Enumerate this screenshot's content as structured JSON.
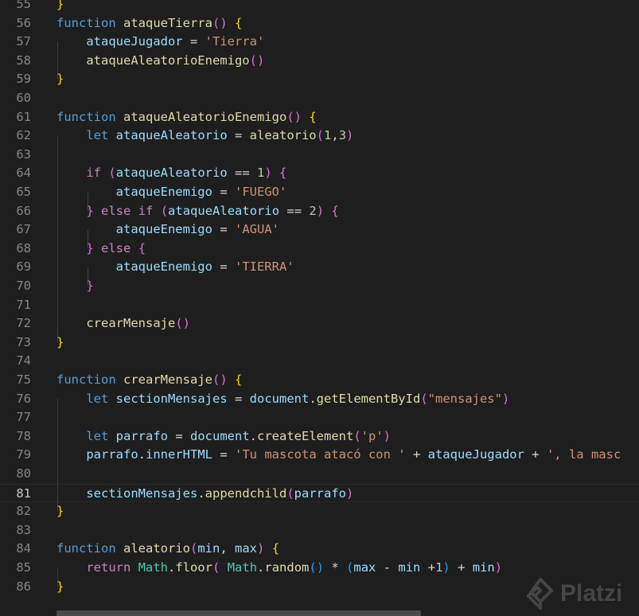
{
  "editor": {
    "lines": [
      {
        "n": "55",
        "tokens": [
          {
            "t": "}",
            "c": "b1"
          }
        ]
      },
      {
        "n": "56",
        "tokens": [
          {
            "t": "function",
            "c": "kw"
          },
          {
            "t": " ",
            "c": "op"
          },
          {
            "t": "ataqueTierra",
            "c": "fn"
          },
          {
            "t": "()",
            "c": "b2"
          },
          {
            "t": " ",
            "c": "op"
          },
          {
            "t": "{",
            "c": "b1"
          }
        ]
      },
      {
        "n": "57",
        "tokens": [
          {
            "t": "    ",
            "c": "op"
          },
          {
            "t": "ataqueJugador",
            "c": "var"
          },
          {
            "t": " = ",
            "c": "op"
          },
          {
            "t": "'Tierra'",
            "c": "str"
          }
        ]
      },
      {
        "n": "58",
        "tokens": [
          {
            "t": "    ",
            "c": "op"
          },
          {
            "t": "ataqueAleatorioEnemigo",
            "c": "fn"
          },
          {
            "t": "()",
            "c": "b2"
          }
        ]
      },
      {
        "n": "59",
        "tokens": [
          {
            "t": "}",
            "c": "b1"
          }
        ]
      },
      {
        "n": "60",
        "tokens": []
      },
      {
        "n": "61",
        "tokens": [
          {
            "t": "function",
            "c": "kw"
          },
          {
            "t": " ",
            "c": "op"
          },
          {
            "t": "ataqueAleatorioEnemigo",
            "c": "fn"
          },
          {
            "t": "()",
            "c": "b2"
          },
          {
            "t": " ",
            "c": "op"
          },
          {
            "t": "{",
            "c": "b1"
          }
        ]
      },
      {
        "n": "62",
        "tokens": [
          {
            "t": "    ",
            "c": "op"
          },
          {
            "t": "let",
            "c": "kw"
          },
          {
            "t": " ",
            "c": "op"
          },
          {
            "t": "ataqueAleatorio",
            "c": "var"
          },
          {
            "t": " = ",
            "c": "op"
          },
          {
            "t": "aleatorio",
            "c": "fn"
          },
          {
            "t": "(",
            "c": "b2"
          },
          {
            "t": "1",
            "c": "num"
          },
          {
            "t": ",",
            "c": "op"
          },
          {
            "t": "3",
            "c": "num"
          },
          {
            "t": ")",
            "c": "b2"
          }
        ]
      },
      {
        "n": "63",
        "tokens": []
      },
      {
        "n": "64",
        "tokens": [
          {
            "t": "    ",
            "c": "op"
          },
          {
            "t": "if",
            "c": "ctl"
          },
          {
            "t": " ",
            "c": "op"
          },
          {
            "t": "(",
            "c": "b2"
          },
          {
            "t": "ataqueAleatorio",
            "c": "var"
          },
          {
            "t": " == ",
            "c": "op"
          },
          {
            "t": "1",
            "c": "num"
          },
          {
            "t": ")",
            "c": "b2"
          },
          {
            "t": " ",
            "c": "op"
          },
          {
            "t": "{",
            "c": "b2"
          }
        ]
      },
      {
        "n": "65",
        "tokens": [
          {
            "t": "        ",
            "c": "op"
          },
          {
            "t": "ataqueEnemigo",
            "c": "var"
          },
          {
            "t": " = ",
            "c": "op"
          },
          {
            "t": "'FUEGO'",
            "c": "str"
          }
        ]
      },
      {
        "n": "66",
        "tokens": [
          {
            "t": "    ",
            "c": "op"
          },
          {
            "t": "}",
            "c": "b2"
          },
          {
            "t": " ",
            "c": "op"
          },
          {
            "t": "else",
            "c": "ctl"
          },
          {
            "t": " ",
            "c": "op"
          },
          {
            "t": "if",
            "c": "ctl"
          },
          {
            "t": " ",
            "c": "op"
          },
          {
            "t": "(",
            "c": "b2"
          },
          {
            "t": "ataqueAleatorio",
            "c": "var"
          },
          {
            "t": " == ",
            "c": "op"
          },
          {
            "t": "2",
            "c": "num"
          },
          {
            "t": ")",
            "c": "b2"
          },
          {
            "t": " ",
            "c": "op"
          },
          {
            "t": "{",
            "c": "b2"
          }
        ]
      },
      {
        "n": "67",
        "tokens": [
          {
            "t": "        ",
            "c": "op"
          },
          {
            "t": "ataqueEnemigo",
            "c": "var"
          },
          {
            "t": " = ",
            "c": "op"
          },
          {
            "t": "'AGUA'",
            "c": "str"
          }
        ]
      },
      {
        "n": "68",
        "tokens": [
          {
            "t": "    ",
            "c": "op"
          },
          {
            "t": "}",
            "c": "b2"
          },
          {
            "t": " ",
            "c": "op"
          },
          {
            "t": "else",
            "c": "ctl"
          },
          {
            "t": " ",
            "c": "op"
          },
          {
            "t": "{",
            "c": "b2"
          }
        ]
      },
      {
        "n": "69",
        "tokens": [
          {
            "t": "        ",
            "c": "op"
          },
          {
            "t": "ataqueEnemigo",
            "c": "var"
          },
          {
            "t": " = ",
            "c": "op"
          },
          {
            "t": "'TIERRA'",
            "c": "str"
          }
        ]
      },
      {
        "n": "70",
        "tokens": [
          {
            "t": "    ",
            "c": "op"
          },
          {
            "t": "}",
            "c": "b2"
          }
        ]
      },
      {
        "n": "71",
        "tokens": []
      },
      {
        "n": "72",
        "tokens": [
          {
            "t": "    ",
            "c": "op"
          },
          {
            "t": "crearMensaje",
            "c": "fn"
          },
          {
            "t": "()",
            "c": "b2"
          }
        ]
      },
      {
        "n": "73",
        "tokens": [
          {
            "t": "}",
            "c": "b1"
          }
        ]
      },
      {
        "n": "74",
        "tokens": []
      },
      {
        "n": "75",
        "tokens": [
          {
            "t": "function",
            "c": "kw"
          },
          {
            "t": " ",
            "c": "op"
          },
          {
            "t": "crearMensaje",
            "c": "fn"
          },
          {
            "t": "()",
            "c": "b2"
          },
          {
            "t": " ",
            "c": "op"
          },
          {
            "t": "{",
            "c": "b1"
          }
        ]
      },
      {
        "n": "76",
        "tokens": [
          {
            "t": "    ",
            "c": "op"
          },
          {
            "t": "let",
            "c": "kw"
          },
          {
            "t": " ",
            "c": "op"
          },
          {
            "t": "sectionMensajes",
            "c": "var"
          },
          {
            "t": " = ",
            "c": "op"
          },
          {
            "t": "document",
            "c": "var"
          },
          {
            "t": ".",
            "c": "op"
          },
          {
            "t": "getElementById",
            "c": "fn"
          },
          {
            "t": "(",
            "c": "b2"
          },
          {
            "t": "\"mensajes\"",
            "c": "str"
          },
          {
            "t": ")",
            "c": "b2"
          }
        ]
      },
      {
        "n": "77",
        "tokens": []
      },
      {
        "n": "78",
        "tokens": [
          {
            "t": "    ",
            "c": "op"
          },
          {
            "t": "let",
            "c": "kw"
          },
          {
            "t": " ",
            "c": "op"
          },
          {
            "t": "parrafo",
            "c": "var"
          },
          {
            "t": " = ",
            "c": "op"
          },
          {
            "t": "document",
            "c": "var"
          },
          {
            "t": ".",
            "c": "op"
          },
          {
            "t": "createElement",
            "c": "fn"
          },
          {
            "t": "(",
            "c": "b2"
          },
          {
            "t": "'p'",
            "c": "str"
          },
          {
            "t": ")",
            "c": "b2"
          }
        ]
      },
      {
        "n": "79",
        "tokens": [
          {
            "t": "    ",
            "c": "op"
          },
          {
            "t": "parrafo",
            "c": "var"
          },
          {
            "t": ".",
            "c": "op"
          },
          {
            "t": "innerHTML",
            "c": "var"
          },
          {
            "t": " = ",
            "c": "op"
          },
          {
            "t": "'Tu mascota atacó con '",
            "c": "str"
          },
          {
            "t": " + ",
            "c": "op"
          },
          {
            "t": "ataqueJugador",
            "c": "var"
          },
          {
            "t": " + ",
            "c": "op"
          },
          {
            "t": "', la masc",
            "c": "str"
          }
        ]
      },
      {
        "n": "80",
        "tokens": []
      },
      {
        "n": "81",
        "tokens": [
          {
            "t": "    ",
            "c": "op"
          },
          {
            "t": "sectionMensajes",
            "c": "var"
          },
          {
            "t": ".",
            "c": "op"
          },
          {
            "t": "appendchild",
            "c": "fn"
          },
          {
            "t": "(",
            "c": "b2"
          },
          {
            "t": "parrafo",
            "c": "var"
          },
          {
            "t": ")",
            "c": "b2"
          }
        ],
        "current": true
      },
      {
        "n": "82",
        "tokens": [
          {
            "t": "}",
            "c": "b1"
          }
        ]
      },
      {
        "n": "83",
        "tokens": []
      },
      {
        "n": "84",
        "tokens": [
          {
            "t": "function",
            "c": "kw"
          },
          {
            "t": " ",
            "c": "op"
          },
          {
            "t": "aleatorio",
            "c": "fn"
          },
          {
            "t": "(",
            "c": "b2"
          },
          {
            "t": "min",
            "c": "var"
          },
          {
            "t": ", ",
            "c": "op"
          },
          {
            "t": "max",
            "c": "var"
          },
          {
            "t": ")",
            "c": "b2"
          },
          {
            "t": " ",
            "c": "op"
          },
          {
            "t": "{",
            "c": "b1"
          }
        ]
      },
      {
        "n": "85",
        "tokens": [
          {
            "t": "    ",
            "c": "op"
          },
          {
            "t": "return",
            "c": "ctl"
          },
          {
            "t": " ",
            "c": "op"
          },
          {
            "t": "Math",
            "c": "cls"
          },
          {
            "t": ".",
            "c": "op"
          },
          {
            "t": "floor",
            "c": "fn"
          },
          {
            "t": "(",
            "c": "b2"
          },
          {
            "t": " ",
            "c": "op"
          },
          {
            "t": "Math",
            "c": "cls"
          },
          {
            "t": ".",
            "c": "op"
          },
          {
            "t": "random",
            "c": "fn"
          },
          {
            "t": "()",
            "c": "b3"
          },
          {
            "t": " * ",
            "c": "op"
          },
          {
            "t": "(",
            "c": "b3"
          },
          {
            "t": "max",
            "c": "var"
          },
          {
            "t": " - ",
            "c": "op"
          },
          {
            "t": "min",
            "c": "var"
          },
          {
            "t": " +",
            "c": "op"
          },
          {
            "t": "1",
            "c": "num"
          },
          {
            "t": ")",
            "c": "b3"
          },
          {
            "t": " + ",
            "c": "op"
          },
          {
            "t": "min",
            "c": "var"
          },
          {
            "t": ")",
            "c": "b2"
          }
        ]
      },
      {
        "n": "86",
        "tokens": [
          {
            "t": "}",
            "c": "b1"
          }
        ]
      }
    ]
  },
  "watermark": {
    "text": "Platzi",
    "icon": "platzi-logo-icon"
  }
}
